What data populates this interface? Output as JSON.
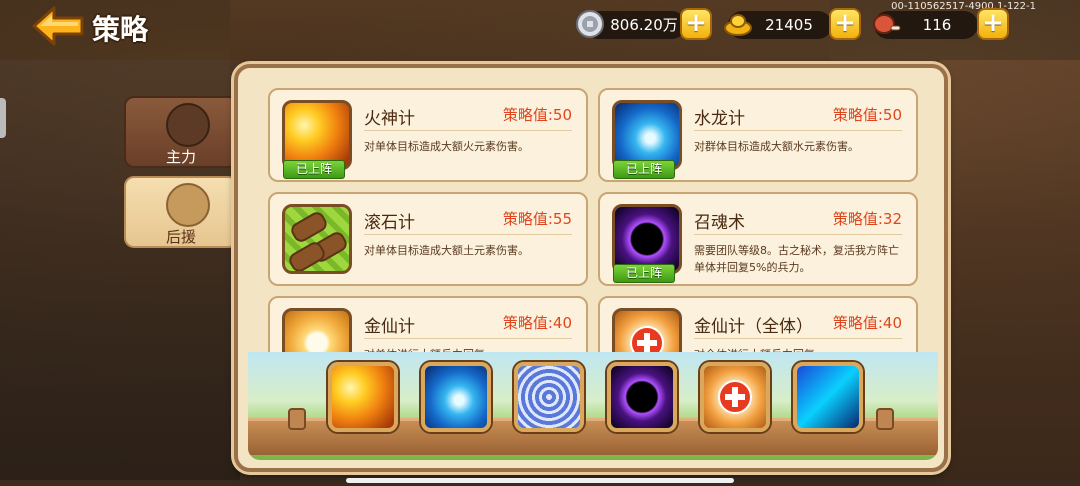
{
  "header": {
    "title": "策略",
    "version": "00-110562517-4900.1-122-1"
  },
  "resources": [
    {
      "name": "silver",
      "icon": "silver-coin-icon",
      "value": "806.20万"
    },
    {
      "name": "gold",
      "icon": "gold-ingot-icon",
      "value": "21405"
    },
    {
      "name": "food",
      "icon": "meat-icon",
      "value": "116"
    }
  ],
  "tabs": [
    {
      "label": "主力",
      "icon": "warrior-icon",
      "active": false
    },
    {
      "label": "后援",
      "icon": "support-icon",
      "active": true
    }
  ],
  "strategies": [
    {
      "name": "火神计",
      "score_label": "策略值:50",
      "desc": "对单体目标造成大额火元素伤害。",
      "badge": "已上阵",
      "icon": "fire-strategy-icon"
    },
    {
      "name": "水龙计",
      "score_label": "策略值:50",
      "desc": "对群体目标造成大额水元素伤害。",
      "badge": "已上阵",
      "icon": "water-strategy-icon"
    },
    {
      "name": "滚石计",
      "score_label": "策略值:55",
      "desc": "对单体目标造成大额土元素伤害。",
      "badge": "",
      "icon": "rock-strategy-icon"
    },
    {
      "name": "召魂术",
      "score_label": "策略值:32",
      "desc": "需要团队等级8。古之秘术，复活我方阵亡单体并回复5%的兵力。",
      "badge": "已上阵",
      "icon": "soul-strategy-icon"
    },
    {
      "name": "金仙计",
      "score_label": "策略值:40",
      "desc": "对单体进行大额兵力回复。",
      "badge": "",
      "icon": "gold-immortal-icon"
    },
    {
      "name": "金仙计（全体）",
      "score_label": "策略值:40",
      "desc": "对全体进行大额兵力回复。",
      "badge": "",
      "icon": "heal-all-icon"
    }
  ],
  "slots": [
    {
      "icon": "fire-strategy-icon"
    },
    {
      "icon": "water-strategy-icon"
    },
    {
      "icon": "spiral-strategy-icon"
    },
    {
      "icon": "soul-strategy-icon"
    },
    {
      "icon": "heal-cross-icon"
    },
    {
      "icon": "blue-slash-icon"
    }
  ]
}
